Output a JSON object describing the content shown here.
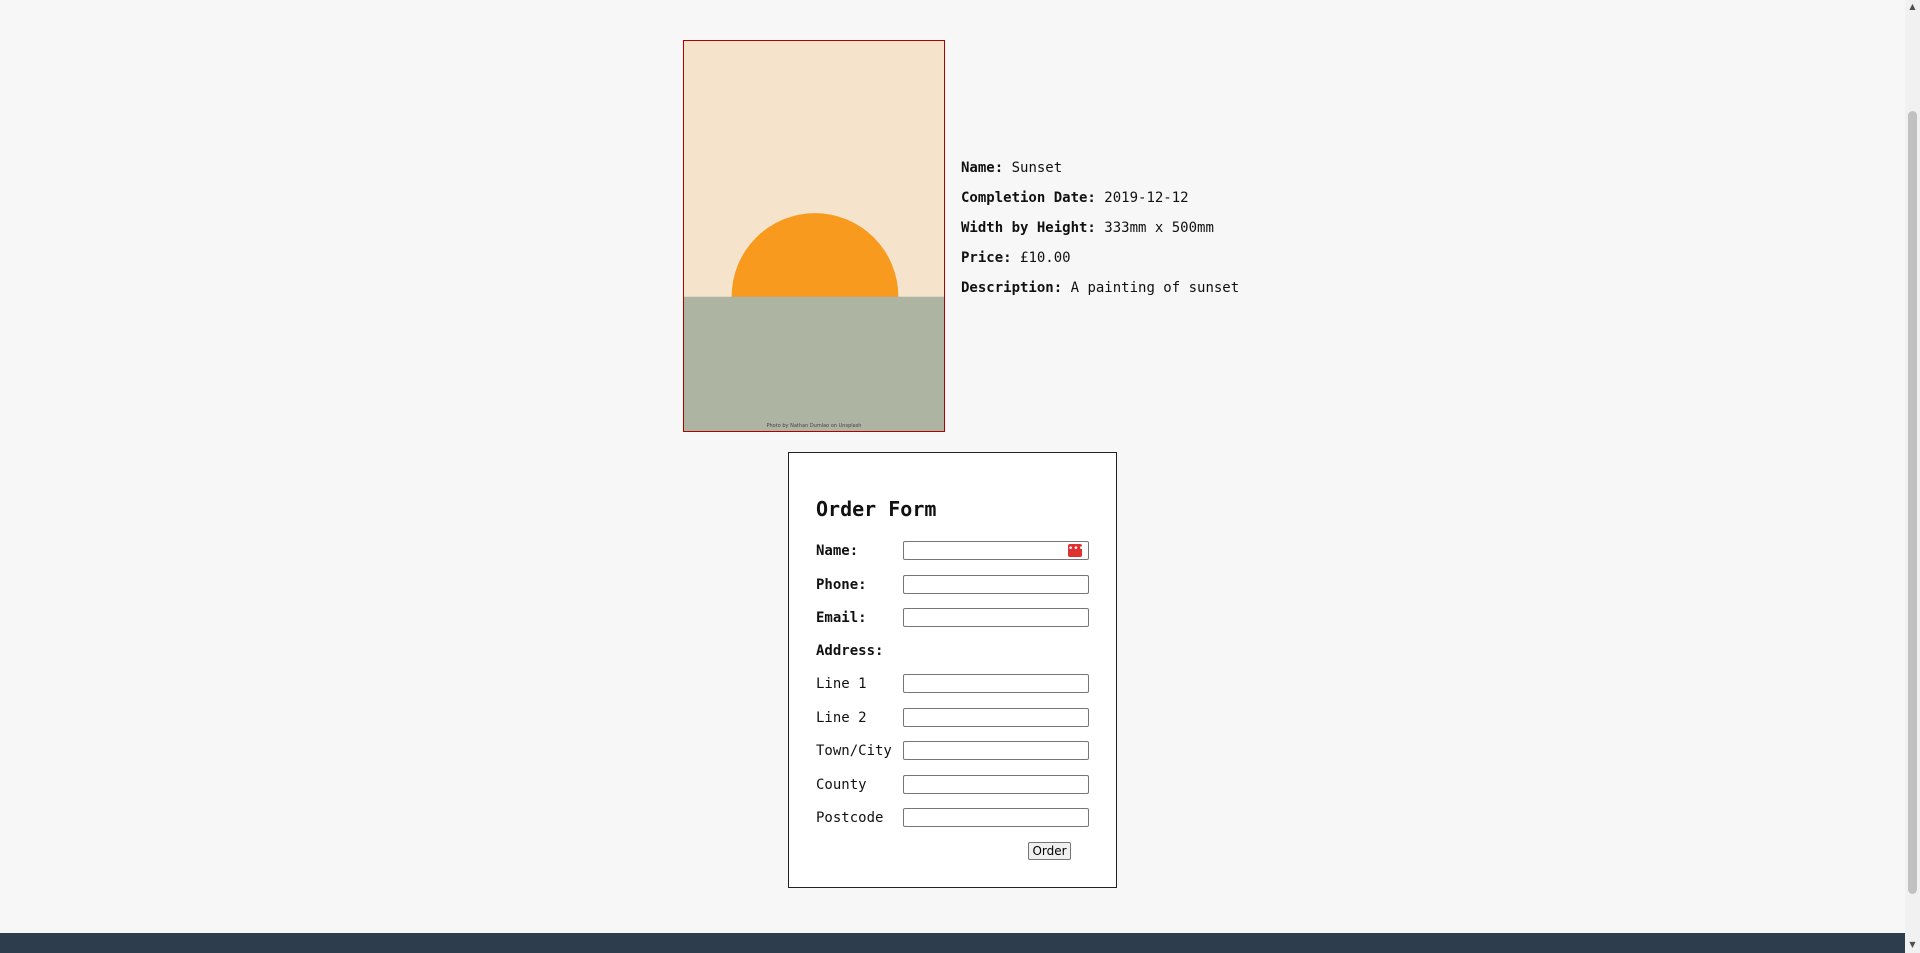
{
  "artwork": {
    "photo_credit": "Photo by Nathan Dumlao on Unsplash",
    "colors": {
      "sky": "#f5e3cc",
      "sun": "#f79a1e",
      "sea": "#adb4a1",
      "frame": "#b00000"
    }
  },
  "details": {
    "name_label": "Name:",
    "name_value": "Sunset",
    "completion_label": "Completion Date:",
    "completion_value": "2019-12-12",
    "size_label": "Width by Height:",
    "size_value": "333mm x 500mm",
    "price_label": "Price:",
    "price_value": "£10.00",
    "description_label": "Description:",
    "description_value": "A painting of sunset"
  },
  "order_form": {
    "title": "Order Form",
    "name_label": "Name:",
    "name_value": "",
    "phone_label": "Phone:",
    "phone_value": "",
    "email_label": "Email:",
    "email_value": "",
    "address_label": "Address:",
    "line1_label": "Line 1",
    "line1_value": "",
    "line2_label": "Line 2",
    "line2_value": "",
    "town_label": "Town/City",
    "town_value": "",
    "county_label": "County",
    "county_value": "",
    "postcode_label": "Postcode",
    "postcode_value": "",
    "autofill_icon": "password-manager-icon",
    "submit_label": "Order"
  },
  "footer": {
    "color": "#2e3d4d"
  }
}
